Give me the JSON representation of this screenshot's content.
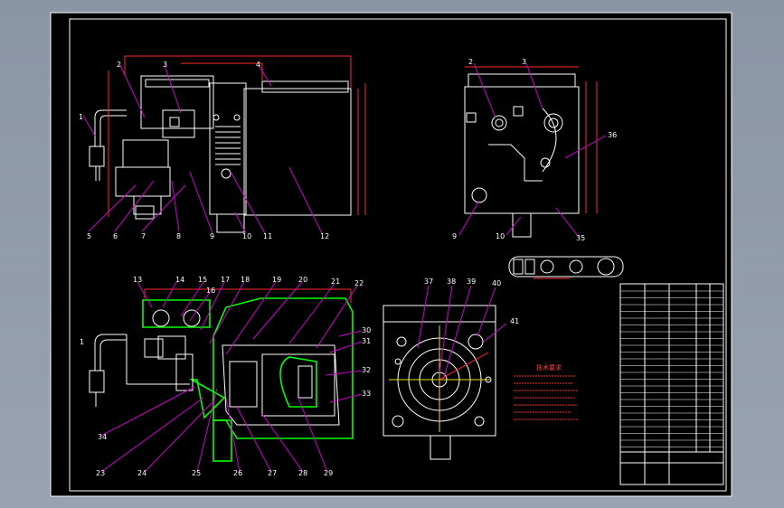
{
  "drawing": {
    "title": "",
    "colors": {
      "background": "#000000",
      "frame": "#ffffff",
      "dimension": "#ff2a2a",
      "leader": "#d000d0",
      "section_hatch": "#00ff00",
      "centerline": "#f0e000"
    }
  },
  "labels_front": [
    "1",
    "2",
    "3",
    "4",
    "5",
    "6",
    "7",
    "8",
    "9",
    "10",
    "11",
    "12"
  ],
  "labels_side": [
    "2",
    "3",
    "36",
    "9",
    "10",
    "35"
  ],
  "labels_section": [
    "13",
    "14",
    "15",
    "16",
    "17",
    "18",
    "19",
    "20",
    "21",
    "22",
    "1",
    "30",
    "31",
    "32",
    "33",
    "34",
    "23",
    "24",
    "25",
    "26",
    "27",
    "28",
    "29"
  ],
  "labels_bottom_view": [
    "37",
    "38",
    "39",
    "40",
    "41"
  ],
  "tech_req_title": "技术要求"
}
